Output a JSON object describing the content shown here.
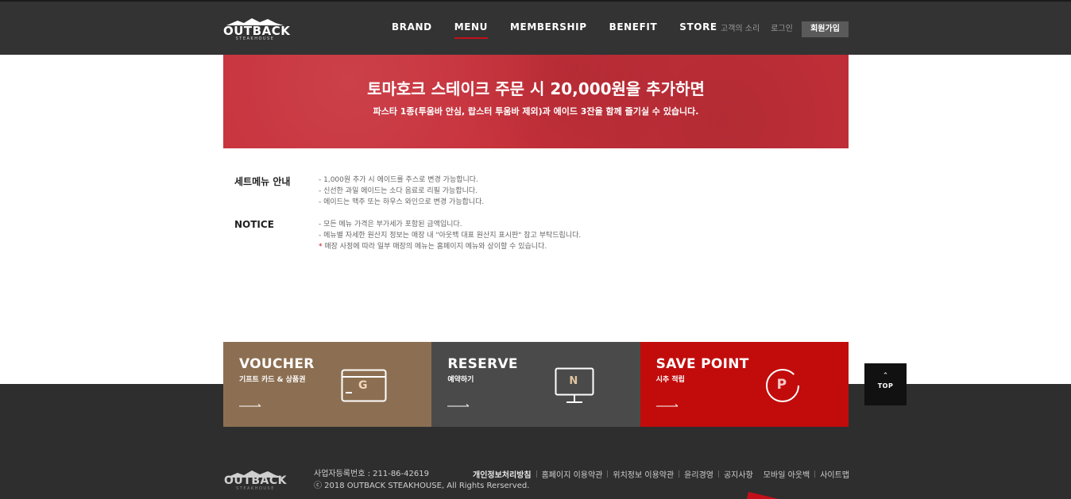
{
  "header": {
    "logo": {
      "main": "OUTBACK",
      "sub": "STEAKHOUSE"
    },
    "nav": [
      {
        "label": "BRAND",
        "active": false
      },
      {
        "label": "MENU",
        "active": true
      },
      {
        "label": "MEMBERSHIP",
        "active": false
      },
      {
        "label": "BENEFIT",
        "active": false
      },
      {
        "label": "STORE",
        "active": false
      }
    ],
    "util": {
      "voice": "고객의 소리",
      "login": "로그인",
      "join": "회원가입"
    }
  },
  "banner": {
    "title": "토마호크 스테이크 주문 시 20,000원을 추가하면",
    "subtitle": "파스타 1종(투움바 안심, 랍스터 투움바 제외)과 에이드 3잔을 함께 즐기실 수 있습니다."
  },
  "info": {
    "set_menu": {
      "heading": "세트메뉴 안내",
      "items": [
        "- 1,000원 추가 시 에이드를 주스로 변경 가능합니다.",
        "- 신선한 과일 에이드는 소다 음료로 리필 가능합니다.",
        "- 에이드는 맥주 또는 하우스 와인으로 변경 가능합니다."
      ]
    },
    "notice": {
      "heading": "NOTICE",
      "items": [
        "- 모든 메뉴 가격은 부가세가 포함된 금액입니다.",
        "- 메뉴별 자세한 원산지 정보는 매장 내 \"아웃백 대표 원산지 표시판\" 참고 부탁드립니다."
      ],
      "star_item": {
        "mark": "*",
        "text": " 매장 사정에 따라 일부 매장의 메뉴는 홈페이지 메뉴와 상이할 수 있습니다."
      }
    }
  },
  "quick": [
    {
      "title": "VOUCHER",
      "sub": "기프트 카드 & 상품권",
      "icon_letter": "G",
      "color": "#8c6f52"
    },
    {
      "title": "RESERVE",
      "sub": "예약하기",
      "icon_letter": "N",
      "color": "#4a4a4a"
    },
    {
      "title": "SAVE POINT",
      "sub": "시추 적립",
      "icon_letter": "P",
      "color": "#c20c0c"
    }
  ],
  "top_button": {
    "label": "TOP"
  },
  "footer": {
    "logo": {
      "main": "OUTBACK",
      "sub": "STEAKHOUSE"
    },
    "biz_no": "사업자등록번호 : 211-86-42619",
    "copyright": "ⓒ 2018 OUTBACK STEAKHOUSE, All Rights Rerserved.",
    "links": [
      {
        "label": "개인정보처리방침",
        "bold": true
      },
      {
        "label": "홈페이지 이용약관",
        "bold": false
      },
      {
        "label": "위치정보 이용약관",
        "bold": false
      },
      {
        "label": "윤리경영",
        "bold": false
      },
      {
        "label": "공지사항",
        "bold": false
      },
      {
        "label": "모바일 아웃백",
        "bold": false
      },
      {
        "label": "사이트맵",
        "bold": false
      }
    ]
  },
  "colors": {
    "header_bg": "#333333",
    "accent_red": "#c40f1a",
    "banner_red": "#c7303a",
    "voucher_brown": "#8c6f52",
    "reserve_gray": "#4a4a4a",
    "point_red": "#c20c0c"
  }
}
